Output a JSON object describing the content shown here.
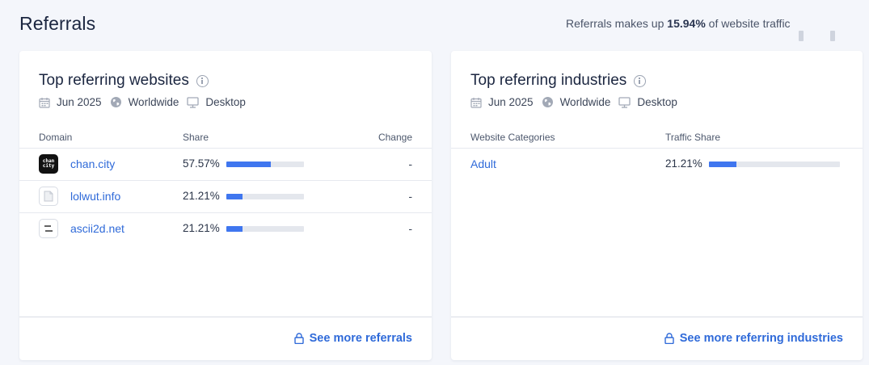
{
  "page": {
    "title": "Referrals",
    "summary_prefix": "Referrals makes up ",
    "summary_value": "15.94%",
    "summary_suffix": " of website traffic"
  },
  "filters": {
    "date": "Jun 2025",
    "region": "Worldwide",
    "device": "Desktop"
  },
  "websites": {
    "title": "Top referring websites",
    "columns": {
      "domain": "Domain",
      "share": "Share",
      "change": "Change"
    },
    "rows": [
      {
        "domain": "chan.city",
        "share": "57.57%",
        "share_value": 57.57,
        "change": "-",
        "icon": "chan-city-favicon",
        "favicon_text": "chan city"
      },
      {
        "domain": "lolwut.info",
        "share": "21.21%",
        "share_value": 21.21,
        "change": "-",
        "icon": "document-icon"
      },
      {
        "domain": "ascii2d.net",
        "share": "21.21%",
        "share_value": 21.21,
        "change": "-",
        "icon": "ascii2d-favicon"
      }
    ],
    "see_more": "See more referrals"
  },
  "industries": {
    "title": "Top referring industries",
    "columns": {
      "category": "Website Categories",
      "traffic": "Traffic Share"
    },
    "rows": [
      {
        "category": "Adult",
        "share": "21.21%",
        "share_value": 21.21
      }
    ],
    "see_more": "See more referring industries"
  },
  "colors": {
    "accent": "#3f76ef",
    "link": "#2f6ad9",
    "bar_track": "#e4e7ed"
  }
}
